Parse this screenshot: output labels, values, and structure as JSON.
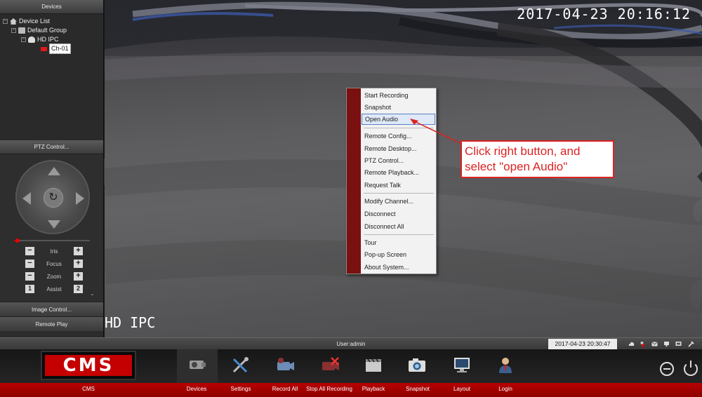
{
  "left_panel": {
    "devices_header": "Devices",
    "tree": [
      {
        "label": "Device List",
        "icon": "home-icon"
      },
      {
        "label": "Default Group",
        "icon": "group-icon"
      },
      {
        "label": "HD IPC",
        "icon": "camera-icon"
      },
      {
        "label": "Ch-01",
        "icon": "channel-icon"
      }
    ],
    "ptz_header": "PTZ Control...",
    "ptz_rows": [
      {
        "label": "Iris"
      },
      {
        "label": "Focus"
      },
      {
        "label": "Zoom"
      },
      {
        "label": "Assist",
        "left": "1",
        "right": "2"
      }
    ],
    "image_control": "Image Control...",
    "remote_play": "Remote Play"
  },
  "video": {
    "timestamp": "2017-04-23 20:16:12",
    "camera_name": "HD IPC"
  },
  "context_menu": {
    "items": [
      {
        "label": "Start Recording"
      },
      {
        "label": "Snapshot"
      },
      {
        "label": "Open Audio",
        "highlighted": true
      },
      {
        "label": "Remote Config..."
      },
      {
        "label": "Remote Desktop..."
      },
      {
        "label": "PTZ Control..."
      },
      {
        "label": "Remote Playback..."
      },
      {
        "label": "Request Talk"
      },
      {
        "label": "Modify Channel..."
      },
      {
        "label": "Disconnect"
      },
      {
        "label": "Disconnect All"
      },
      {
        "label": "Tour"
      },
      {
        "label": "Pop-up Screen"
      },
      {
        "label": "About System..."
      }
    ]
  },
  "annotation": {
    "text": "Click right button, and select \"open Audio\"",
    "color": "#dd2222"
  },
  "status_bar": {
    "user": "User:admin",
    "clock": "2017-04-23 20:30:47"
  },
  "toolbar": {
    "logo": "CMS",
    "logo_label": "CMS",
    "tools": [
      {
        "label": "Devices",
        "icon": "devices-icon"
      },
      {
        "label": "Settings",
        "icon": "settings-icon"
      },
      {
        "label": "Record All",
        "icon": "record-all-icon"
      },
      {
        "label": "Stop All Recording",
        "icon": "stop-recording-icon"
      },
      {
        "label": "Playback",
        "icon": "playback-icon"
      },
      {
        "label": "Snapshot",
        "icon": "snapshot-icon"
      },
      {
        "label": "Layout",
        "icon": "layout-icon"
      },
      {
        "label": "Login",
        "icon": "login-icon"
      }
    ]
  },
  "colors": {
    "brand_red": "#c40000",
    "menu_strip": "#7a1010",
    "highlight": "#dfe9f7"
  }
}
